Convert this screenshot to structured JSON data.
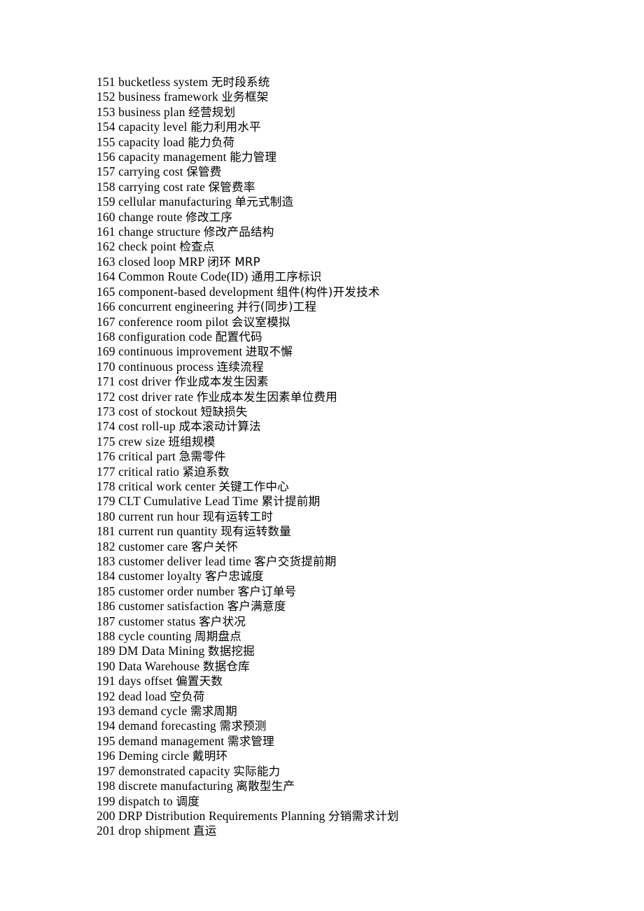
{
  "page": {
    "background_color": "#ffffff",
    "text_color": "#000000",
    "kind": "glossary-page"
  },
  "glossary": {
    "entries": [
      {
        "num": "151",
        "term": "bucketless system",
        "gloss": "无时段系统"
      },
      {
        "num": "152",
        "term": "business framework",
        "gloss": "业务框架"
      },
      {
        "num": "153",
        "term": "business plan",
        "gloss": "经营规划"
      },
      {
        "num": "154",
        "term": "capacity level",
        "gloss": "能力利用水平"
      },
      {
        "num": "155",
        "term": "capacity load",
        "gloss": "能力负荷"
      },
      {
        "num": "156",
        "term": "capacity management",
        "gloss": "能力管理"
      },
      {
        "num": "157",
        "term": "carrying cost",
        "gloss": "保管费"
      },
      {
        "num": "158",
        "term": "carrying cost rate",
        "gloss": "保管费率"
      },
      {
        "num": "159",
        "term": "cellular manufacturing",
        "gloss": "单元式制造"
      },
      {
        "num": "160",
        "term": "change route",
        "gloss": "修改工序"
      },
      {
        "num": "161",
        "term": "change structure",
        "gloss": "修改产品结构"
      },
      {
        "num": "162",
        "term": "check point",
        "gloss": "检查点"
      },
      {
        "num": "163",
        "term": "closed loop MRP",
        "gloss": "闭环 MRP"
      },
      {
        "num": "164",
        "term": "Common Route Code(ID)",
        "gloss": "通用工序标识"
      },
      {
        "num": "165",
        "term": "component-based development",
        "gloss": "组件(构件)开发技术"
      },
      {
        "num": "166",
        "term": "concurrent engineering",
        "gloss": "并行(同步)工程"
      },
      {
        "num": "167",
        "term": "conference room pilot",
        "gloss": "会议室模拟"
      },
      {
        "num": "168",
        "term": "configuration code",
        "gloss": "配置代码"
      },
      {
        "num": "169",
        "term": "continuous improvement",
        "gloss": "进取不懈"
      },
      {
        "num": "170",
        "term": "continuous process",
        "gloss": "连续流程"
      },
      {
        "num": "171",
        "term": "cost driver",
        "gloss": "作业成本发生因素"
      },
      {
        "num": "172",
        "term": "cost driver rate",
        "gloss": "作业成本发生因素单位费用"
      },
      {
        "num": "173",
        "term": "cost of stockout",
        "gloss": "短缺损失"
      },
      {
        "num": "174",
        "term": "cost roll-up",
        "gloss": "成本滚动计算法"
      },
      {
        "num": "175",
        "term": "crew size",
        "gloss": "班组规模"
      },
      {
        "num": "176",
        "term": "critical part",
        "gloss": "急需零件"
      },
      {
        "num": "177",
        "term": "critical ratio",
        "gloss": "紧迫系数"
      },
      {
        "num": "178",
        "term": "critical work center",
        "gloss": "关键工作中心"
      },
      {
        "num": "179",
        "term": "CLT Cumulative Lead Time",
        "gloss": "累计提前期"
      },
      {
        "num": "180",
        "term": "current run hour",
        "gloss": "现有运转工时"
      },
      {
        "num": "181",
        "term": "current run quantity",
        "gloss": "现有运转数量"
      },
      {
        "num": "182",
        "term": "customer care",
        "gloss": "客户关怀"
      },
      {
        "num": "183",
        "term": "customer deliver lead time",
        "gloss": "客户交货提前期"
      },
      {
        "num": "184",
        "term": "customer loyalty",
        "gloss": "客户忠诚度"
      },
      {
        "num": "185",
        "term": "customer order number",
        "gloss": "客户订单号"
      },
      {
        "num": "186",
        "term": "customer satisfaction",
        "gloss": "客户满意度"
      },
      {
        "num": "187",
        "term": "customer status",
        "gloss": "客户状况"
      },
      {
        "num": "188",
        "term": "cycle counting",
        "gloss": "周期盘点"
      },
      {
        "num": "189",
        "term": "DM Data Mining",
        "gloss": "数据挖掘"
      },
      {
        "num": "190",
        "term": "Data Warehouse",
        "gloss": "数据仓库"
      },
      {
        "num": "191",
        "term": "days offset",
        "gloss": "偏置天数"
      },
      {
        "num": "192",
        "term": "dead load",
        "gloss": "空负荷"
      },
      {
        "num": "193",
        "term": "demand cycle",
        "gloss": "需求周期"
      },
      {
        "num": "194",
        "term": "demand forecasting",
        "gloss": "需求预测"
      },
      {
        "num": "195",
        "term": "demand management",
        "gloss": "需求管理"
      },
      {
        "num": "196",
        "term": "Deming circle",
        "gloss": "戴明环"
      },
      {
        "num": "197",
        "term": "demonstrated capacity",
        "gloss": "实际能力"
      },
      {
        "num": "198",
        "term": "discrete manufacturing",
        "gloss": "离散型生产"
      },
      {
        "num": "199",
        "term": "dispatch to",
        "gloss": "调度"
      },
      {
        "num": "200",
        "term": "DRP Distribution Requirements Planning",
        "gloss": "分销需求计划"
      },
      {
        "num": "201",
        "term": "drop shipment",
        "gloss": "直运"
      }
    ]
  }
}
